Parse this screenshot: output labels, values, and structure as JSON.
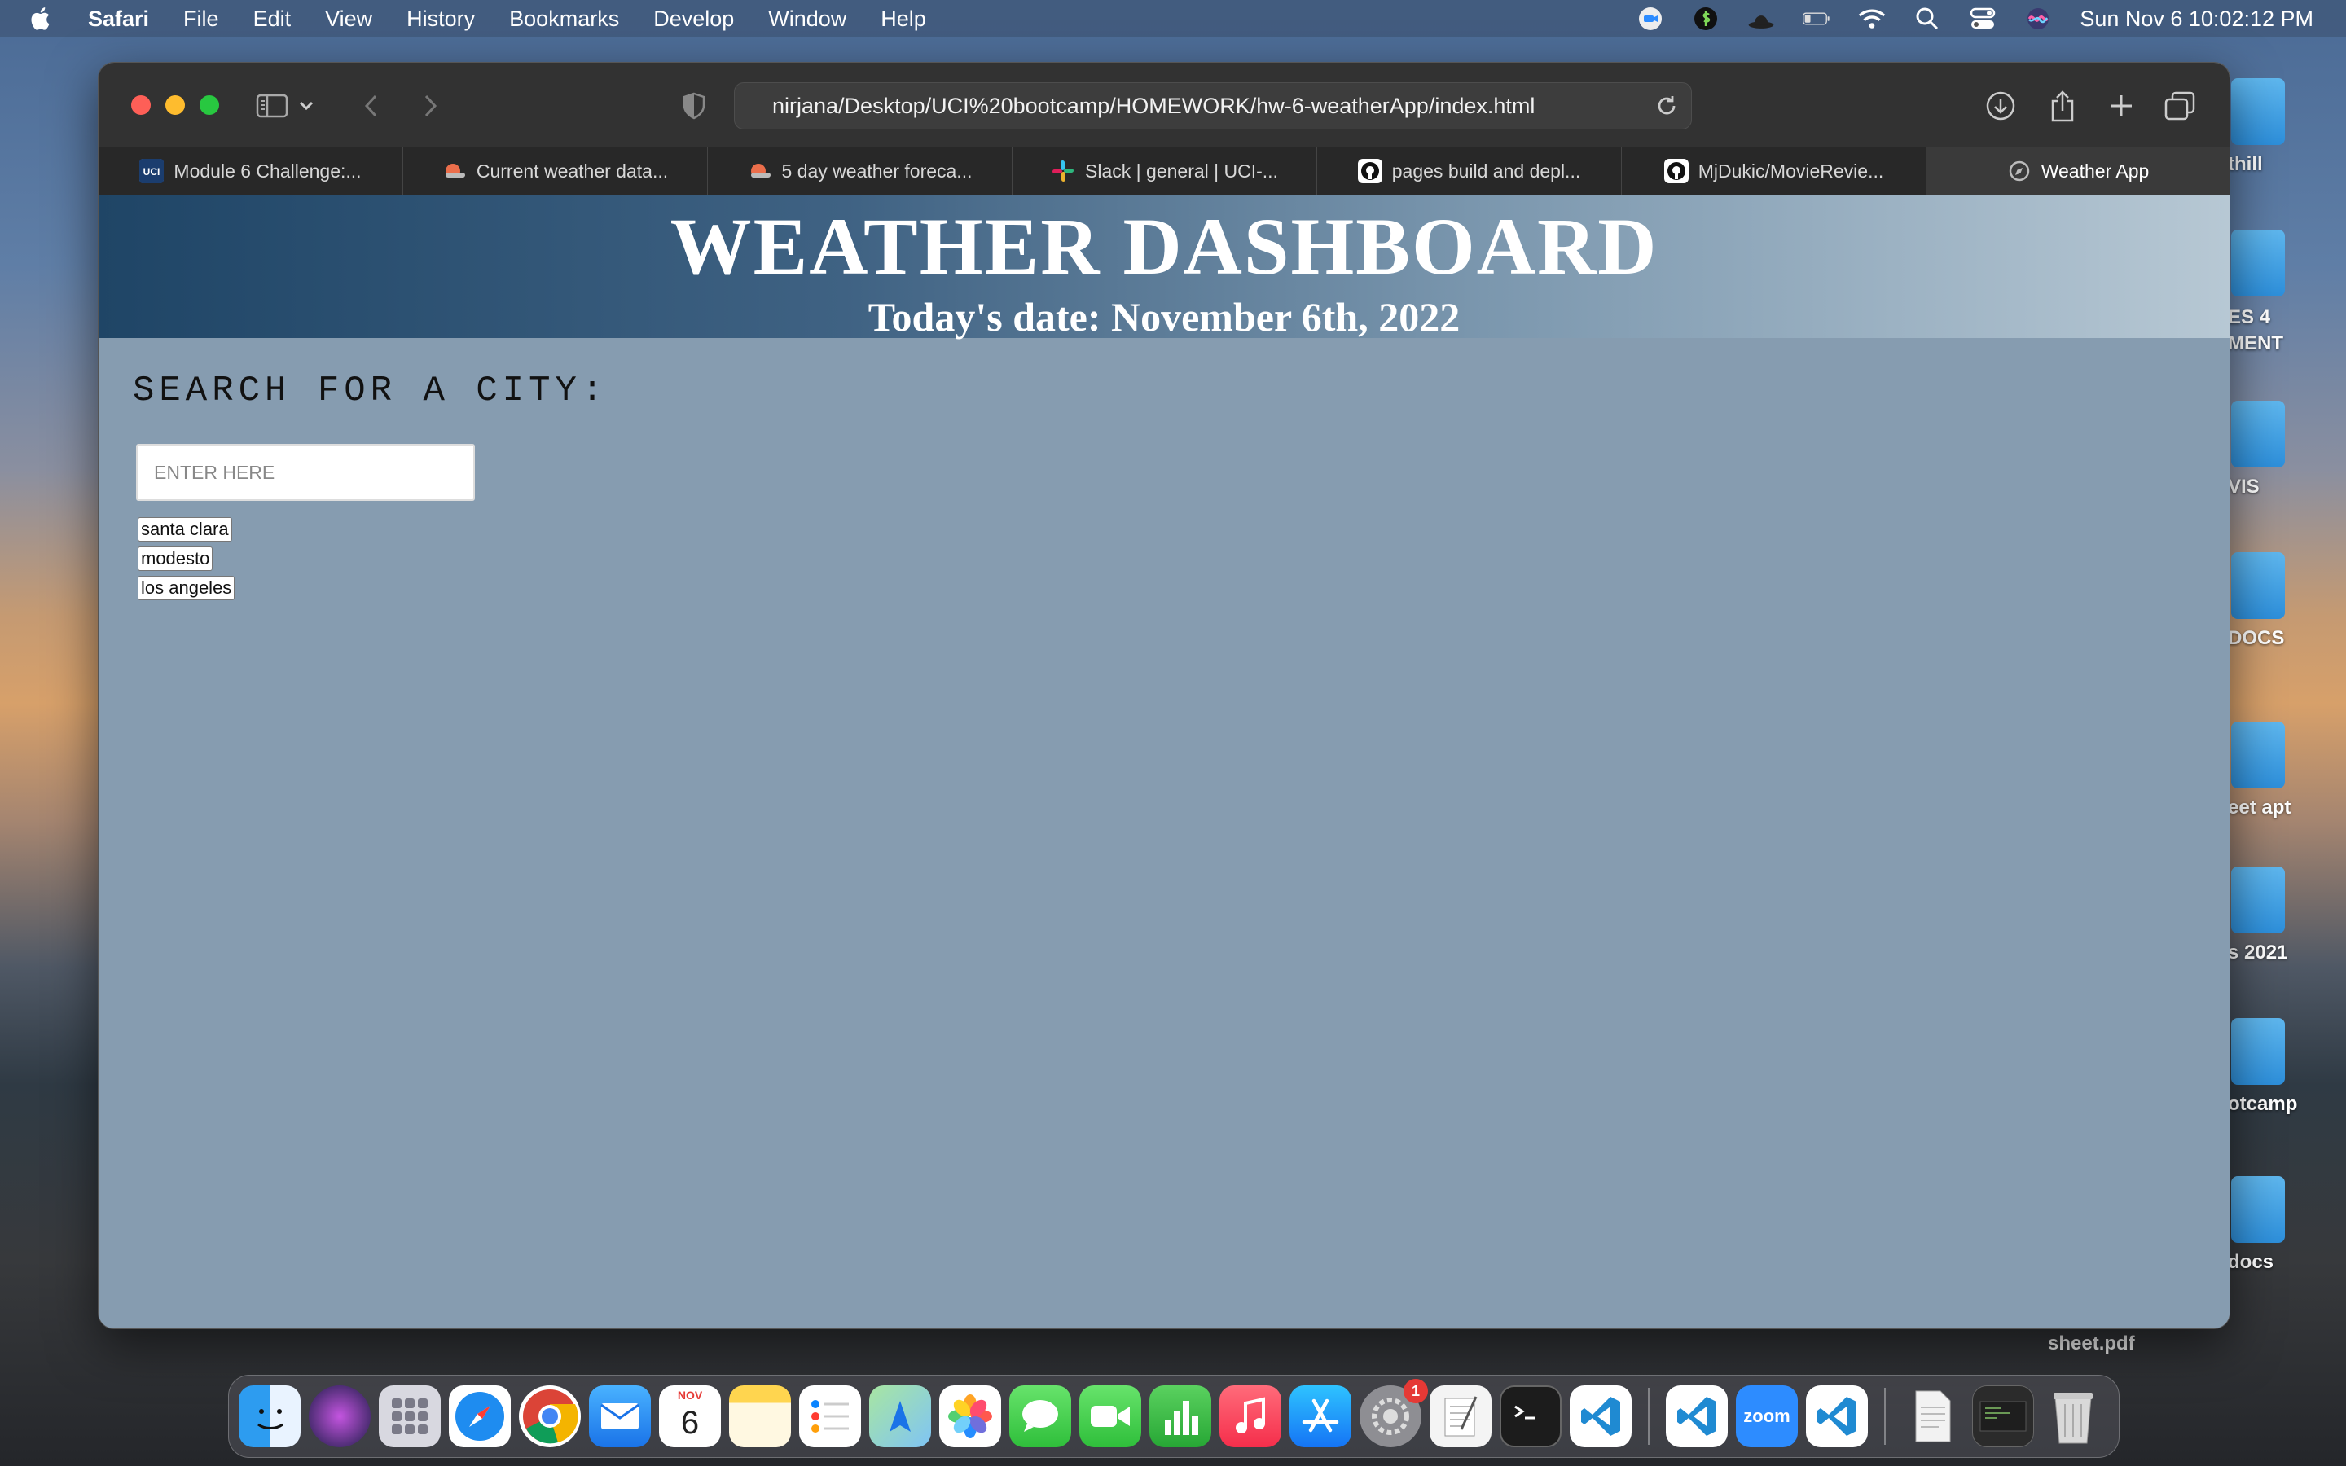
{
  "menubar": {
    "app_name": "Safari",
    "items": [
      "File",
      "Edit",
      "View",
      "History",
      "Bookmarks",
      "Develop",
      "Window",
      "Help"
    ],
    "clock": "Sun Nov 6  10:02:12 PM"
  },
  "desktop": {
    "items": [
      {
        "label": "thill"
      },
      {
        "label": "ES 4\nMENT"
      },
      {
        "label": "VIS"
      },
      {
        "label": "DOCS"
      },
      {
        "label": "eet apt"
      },
      {
        "label": "s 2021"
      },
      {
        "label": "otcamp"
      },
      {
        "label": "docs"
      }
    ],
    "sheet_label": "sheet.pdf"
  },
  "browser": {
    "url": "nirjana/Desktop/UCI%20bootcamp/HOMEWORK/hw-6-weatherApp/index.html",
    "tabs": [
      {
        "label": "Module 6 Challenge:...",
        "icon": "uci-icon"
      },
      {
        "label": "Current weather data...",
        "icon": "openweather-icon"
      },
      {
        "label": "5 day weather foreca...",
        "icon": "openweather-icon"
      },
      {
        "label": "Slack | general | UCI-...",
        "icon": "slack-icon"
      },
      {
        "label": "pages build and depl...",
        "icon": "github-icon"
      },
      {
        "label": "MjDukic/MovieRevie...",
        "icon": "github-icon"
      },
      {
        "label": "Weather App",
        "icon": "compass-icon",
        "active": true
      }
    ]
  },
  "page": {
    "title": "WEATHER DASHBOARD",
    "date_line": "Today's date:  November 6th, 2022",
    "search_heading": "SEARCH FOR A CITY:",
    "search_placeholder": "ENTER HERE",
    "history": [
      "santa clara",
      "modesto",
      "los angeles"
    ]
  },
  "dock": {
    "calendar_month": "NOV",
    "calendar_day": "6",
    "settings_badge": "1",
    "zoom_label": "zoom"
  },
  "colors": {
    "page_background": "#869cb0",
    "hero_left": "#1f4566",
    "hero_right": "#b7c8d4"
  }
}
